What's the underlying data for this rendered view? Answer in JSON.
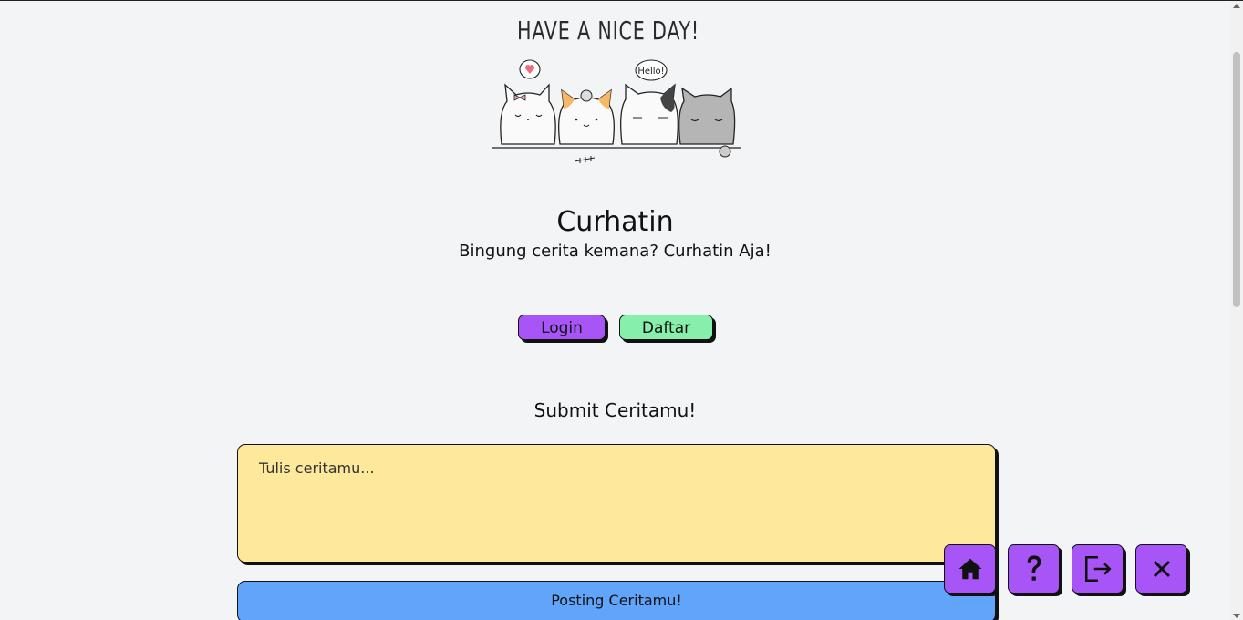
{
  "banner": {
    "text": "HAVE A NICE DAY!",
    "speech_bubble_text": "Hello!"
  },
  "header": {
    "title": "Curhatin",
    "subtitle": "Bingung cerita kemana? Curhatin Aja!"
  },
  "auth": {
    "login_label": "Login",
    "register_label": "Daftar"
  },
  "story": {
    "section_title": "Submit Ceritamu!",
    "placeholder": "Tulis ceritamu...",
    "post_label": "Posting Ceritamu!"
  },
  "floating_actions": [
    {
      "icon": "home-icon"
    },
    {
      "icon": "help-icon"
    },
    {
      "icon": "logout-icon"
    },
    {
      "icon": "close-icon"
    }
  ],
  "colors": {
    "background": "#f3f4f6",
    "purple": "#a855f7",
    "green": "#86efac",
    "yellow": "#fde89c",
    "blue": "#60a5fa"
  }
}
